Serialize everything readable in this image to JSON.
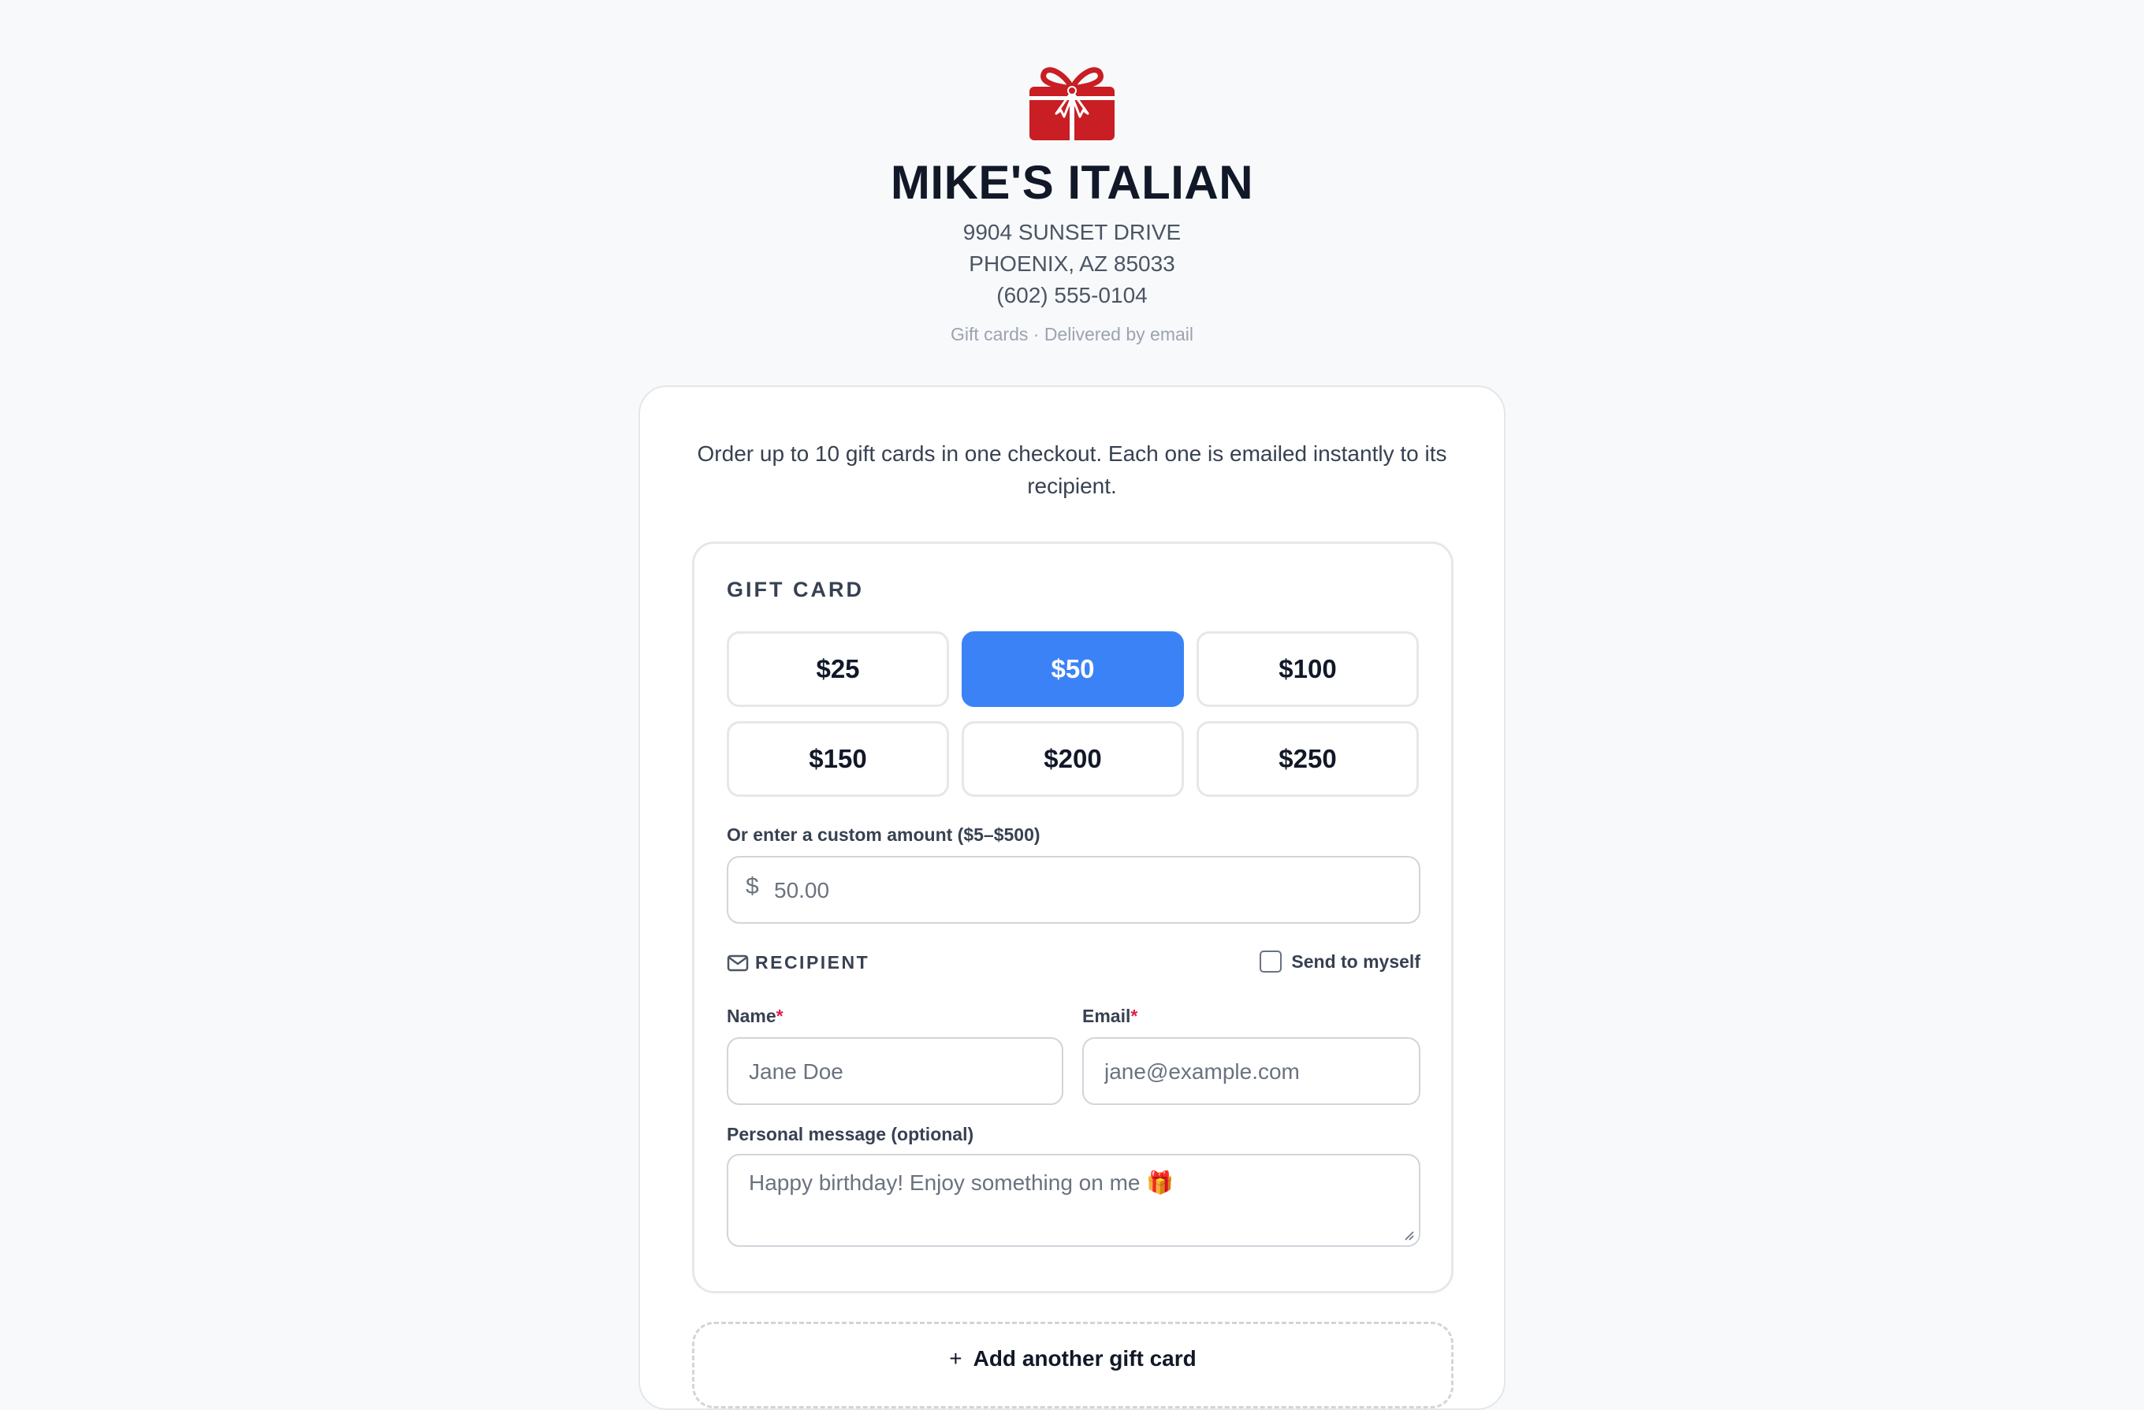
{
  "restaurant": {
    "name": "MIKE'S ITALIAN",
    "address_line1": "9904 SUNSET DRIVE",
    "address_line2": "PHOENIX, AZ 85033",
    "phone": "(602) 555-0104",
    "tagline": "Gift cards · Delivered by email"
  },
  "intro_text": "Order up to 10 gift cards in one checkout. Each one is emailed instantly to its recipient.",
  "gift_card": {
    "title": "GIFT CARD",
    "amounts": [
      "$25",
      "$50",
      "$100",
      "$150",
      "$200",
      "$250"
    ],
    "selected_amount": "$50",
    "custom_amount_label": "Or enter a custom amount ($5–$500)",
    "currency_symbol": "$",
    "custom_amount_placeholder": "50.00"
  },
  "recipient": {
    "title": "RECIPIENT",
    "send_to_myself_label": "Send to myself",
    "send_to_myself_checked": false,
    "name_label": "Name",
    "name_placeholder": "Jane Doe",
    "email_label": "Email",
    "email_placeholder": "jane@example.com",
    "required_marker": "*",
    "message_label": "Personal message (optional)",
    "message_placeholder": "Happy birthday! Enjoy something on me 🎁"
  },
  "add_another_label": "Add another gift card",
  "add_another_icon": "+",
  "colors": {
    "brand_red": "#c81e24",
    "accent_blue": "#3b82f6",
    "required_red": "#e11d48"
  }
}
